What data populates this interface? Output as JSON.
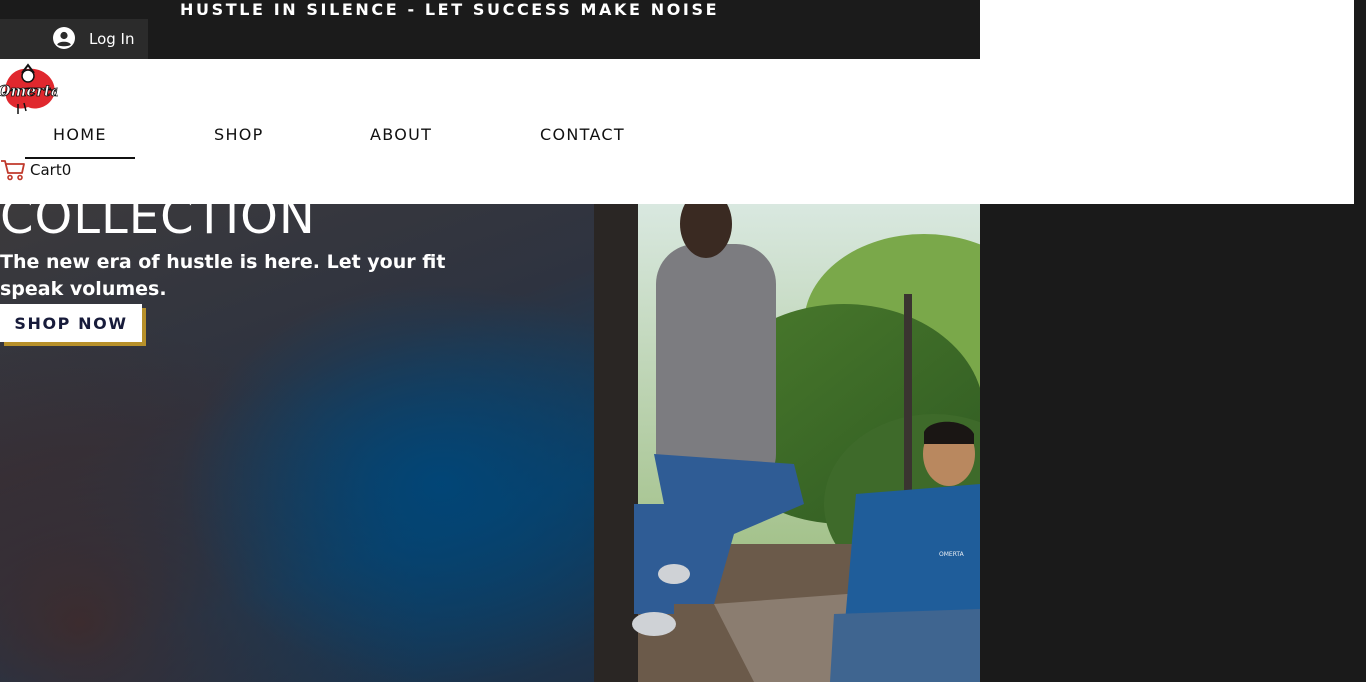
{
  "topbar": {
    "tagline": "HUSTLE IN SILENCE - LET SUCCESS MAKE NOISE",
    "login_label": "Log In",
    "login_icon": "user-avatar-icon"
  },
  "header": {
    "logo_text": "Omerta",
    "nav": [
      {
        "label": "HOME",
        "active": true
      },
      {
        "label": "SHOP",
        "active": false
      },
      {
        "label": "ABOUT",
        "active": false
      },
      {
        "label": "CONTACT",
        "active": false
      }
    ],
    "cart_label": "Cart",
    "cart_count": "0",
    "cart_icon": "shopping-cart-icon"
  },
  "hero": {
    "heading": "COLLECTION",
    "subheading": "The new era of hustle is here. Let your fit speak volumes.",
    "cta_label": "SHOP NOW"
  },
  "colors": {
    "topbar_bg": "#1b1b1b",
    "accent_gold": "#b7902a",
    "cta_text": "#171b3a",
    "logo_red": "#e0282e"
  }
}
